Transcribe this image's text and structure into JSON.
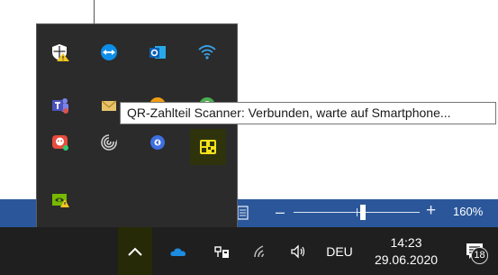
{
  "tooltip": {
    "text": "QR-Zahlteil Scanner: Verbunden, warte auf Smartphone..."
  },
  "statusbar": {
    "zoom_minus": "–",
    "zoom_plus": "+",
    "zoom_level": "160%",
    "zoom_slider_value": 0.53
  },
  "taskbar": {
    "language": "DEU",
    "time": "14:23",
    "date": "29.06.2020",
    "notification_count": "18"
  },
  "tray_icons": [
    "windows-security-warning-icon",
    "teamviewer-icon",
    "outlook-icon",
    "wifi-icon",
    "teams-icon",
    "mail-icon",
    "orange-app-icon",
    "green-sync-icon",
    "red-chat-app-icon",
    "fingerprint-icon",
    "blue-circle-app-icon",
    "qr-scanner-icon",
    "nvidia-warning-icon"
  ],
  "colors": {
    "taskbar": "#1f1f1f",
    "statusbar": "#2b579a",
    "overflow": "#2b2b2b",
    "qr_highlight": "#2f330b",
    "chevron_highlight": "#262a06"
  }
}
